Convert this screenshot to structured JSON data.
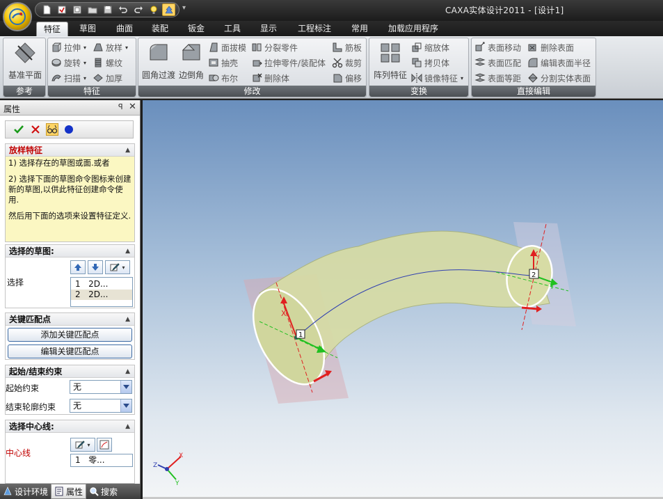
{
  "window": {
    "title": "CAXA实体设计2011 - [设计1]"
  },
  "quick_access": [
    {
      "icon": "new-document-icon"
    },
    {
      "icon": "open-email-icon"
    },
    {
      "icon": "new-folder-icon"
    },
    {
      "icon": "open-folder-icon"
    },
    {
      "icon": "save-icon"
    },
    {
      "icon": "undo-icon"
    },
    {
      "icon": "redo-icon"
    },
    {
      "icon": "light-bulb-icon"
    },
    {
      "icon": "design-tree-icon"
    }
  ],
  "tabs": [
    "特征",
    "草图",
    "曲面",
    "装配",
    "钣金",
    "工具",
    "显示",
    "工程标注",
    "常用",
    "加载应用程序"
  ],
  "active_tab": "特征",
  "ribbon": {
    "ref_group": {
      "label": "参考",
      "base_plane": "基准平面"
    },
    "feature_group": {
      "label": "特征",
      "extrude": "拉伸",
      "loft": "放样",
      "revolve": "旋转",
      "thread": "螺纹",
      "sweep": "扫描",
      "thicken": "加厚"
    },
    "modify_group": {
      "label": "修改",
      "fillet": "圆角过渡",
      "chamfer": "边倒角",
      "draft": "面拔模",
      "shell": "抽壳",
      "boolean": "布尔",
      "split_part": "分裂零件",
      "extrude_part": "拉伸零件/装配体",
      "delete_body": "删除体",
      "rib": "筋板",
      "cut": "裁剪",
      "offset": "偏移"
    },
    "transform_group": {
      "label": "变换",
      "pattern": "阵列特征",
      "scale": "缩放体",
      "copy": "拷贝体",
      "mirror": "镜像特征"
    },
    "direct_group": {
      "label": "直接编辑",
      "move_face": "表面移动",
      "match_face": "表面匹配",
      "equal_face": "表面等距",
      "delete_face": "删除表面",
      "edit_radius": "编辑表面半径",
      "split_solid": "分割实体表面"
    }
  },
  "panel": {
    "title": "属性",
    "pin": "ꟼ",
    "close": "✕",
    "help": {
      "header": "放样特征",
      "line1": "1) 选择存在的草图或面.或者",
      "line2": "2) 选择下面的草图命令图标来创建新的草图,以供此特征创建命令使用.",
      "line3": "然后用下面的选项来设置特征定义."
    },
    "sketch_section": {
      "header": "选择的草图:",
      "row_label": "选择",
      "items": [
        {
          "num": "1",
          "text": "2D..."
        },
        {
          "num": "2",
          "text": "2D..."
        }
      ]
    },
    "keymatch_section": {
      "header": "关键匹配点",
      "add": "添加关键匹配点",
      "edit": "编辑关键匹配点"
    },
    "constraint_section": {
      "header": "起始/结束约束",
      "start_label": "起始约束",
      "start_value": "无",
      "end_label": "结束轮廓约束",
      "end_value": "无"
    },
    "centerline_section": {
      "header": "选择中心线:",
      "label": "中心线",
      "item_num": "1",
      "item_text": "零..."
    }
  },
  "bottom_tabs": [
    "设计环境",
    "属性",
    "搜索"
  ],
  "active_bottom_tab": "属性",
  "viewport": {
    "profile1_label": "1",
    "profile2_label": "2",
    "axis_x": "X",
    "axis_y": "Y",
    "triad_x": "X",
    "triad_y": "Y",
    "triad_z": "Z"
  },
  "colors": {
    "loft_surface": "#d7dca5",
    "profile_ring": "#ffffff",
    "axis_red": "#e02020",
    "axis_green": "#20c020",
    "path_blue": "#3040b0",
    "help_background": "#fbf7c2"
  }
}
